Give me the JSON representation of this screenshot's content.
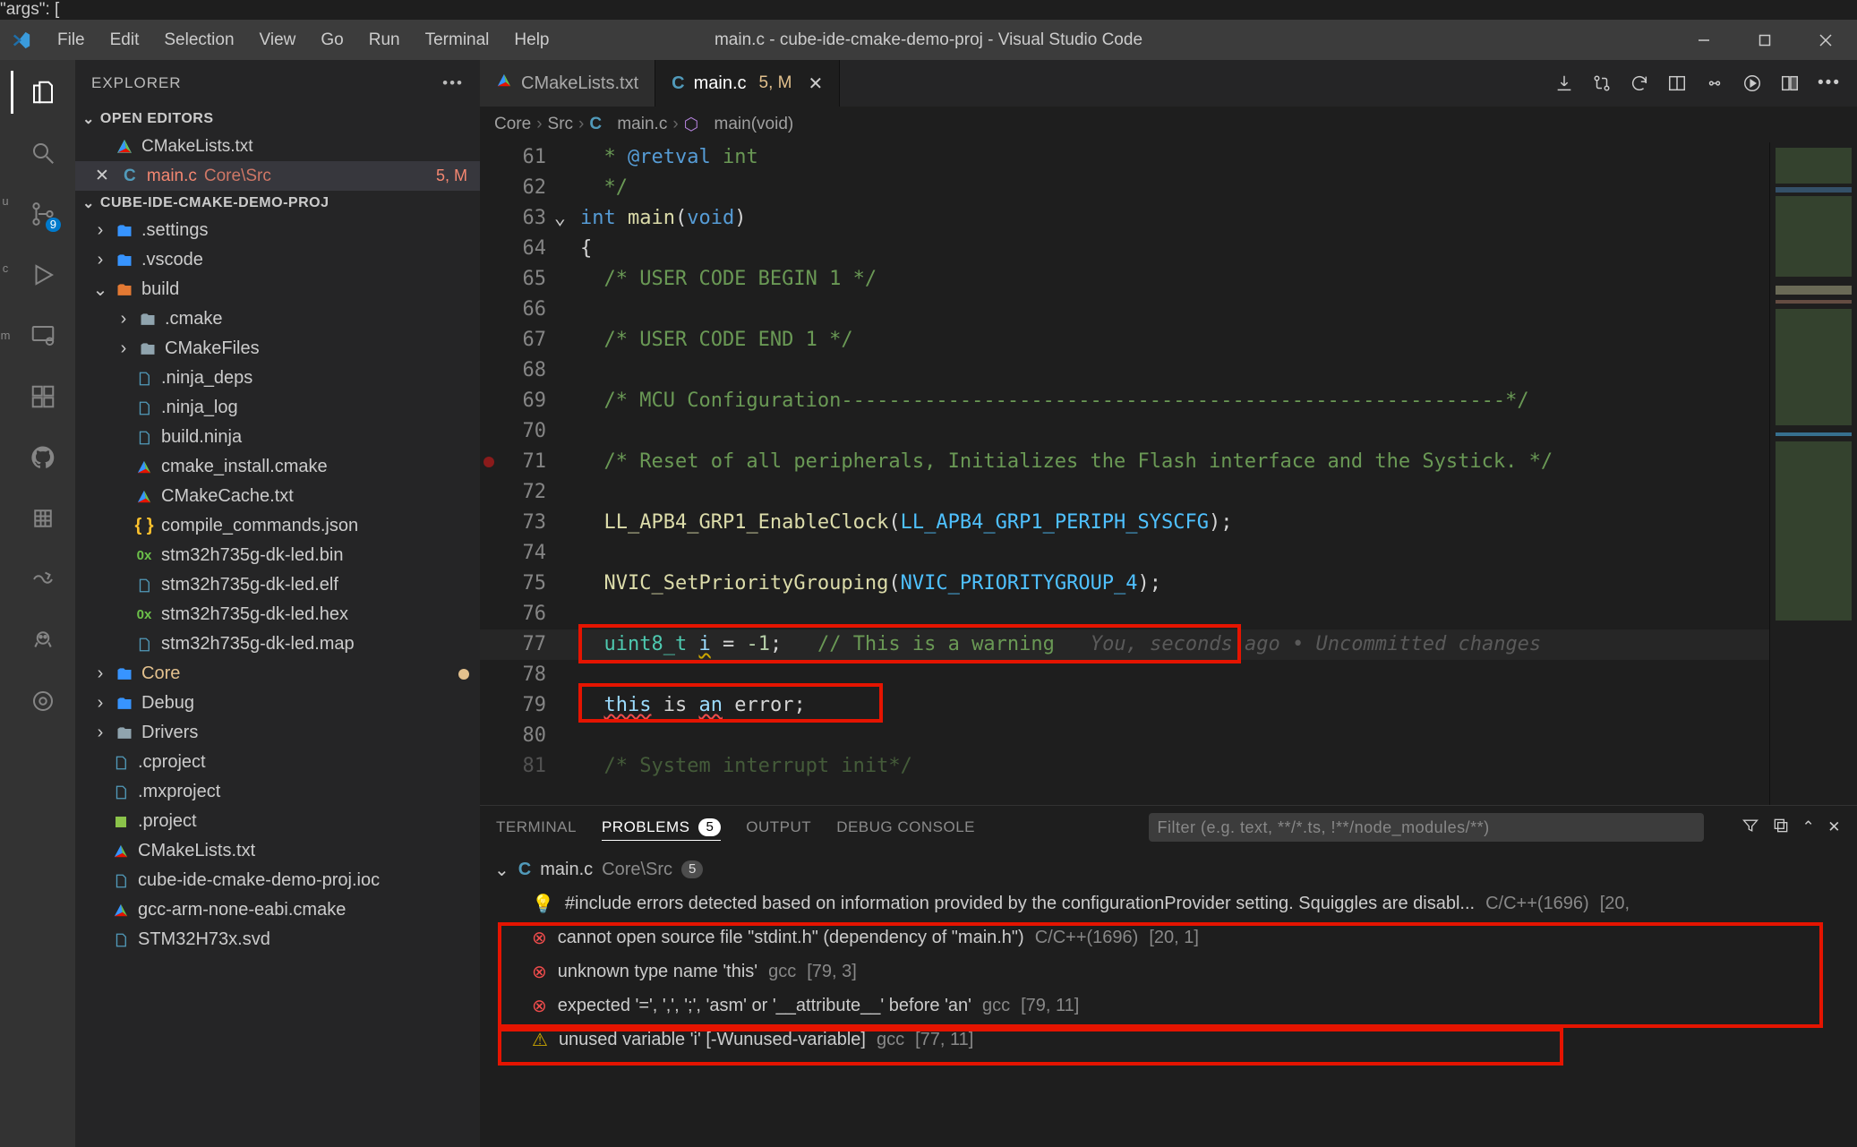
{
  "title": "main.c - cube-ide-cmake-demo-proj - Visual Studio Code",
  "top_snippet": "\"args\": [",
  "menu": [
    "File",
    "Edit",
    "Selection",
    "View",
    "Go",
    "Run",
    "Terminal",
    "Help"
  ],
  "left_letters": [
    "u",
    "c",
    "m"
  ],
  "sidebar": {
    "title": "EXPLORER",
    "sections": {
      "open_editors": {
        "label": "OPEN EDITORS",
        "items": [
          {
            "icon": "cmake-triangle",
            "name": "CMakeLists.txt",
            "close": false
          },
          {
            "icon": "c-file",
            "name": "main.c",
            "sub": "Core\\Src",
            "status": "5, M",
            "close": true,
            "active": true
          }
        ]
      },
      "folder": {
        "label": "CUBE-IDE-CMAKE-DEMO-PROJ",
        "tree": [
          {
            "depth": 0,
            "chev": "right",
            "icon": "folder-blue",
            "name": ".settings"
          },
          {
            "depth": 0,
            "chev": "right",
            "icon": "folder-blue",
            "name": ".vscode"
          },
          {
            "depth": 0,
            "chev": "down",
            "icon": "folder-red",
            "name": "build"
          },
          {
            "depth": 1,
            "chev": "right",
            "icon": "folder-grey",
            "name": ".cmake"
          },
          {
            "depth": 1,
            "chev": "right",
            "icon": "folder-grey",
            "name": "CMakeFiles"
          },
          {
            "depth": 1,
            "icon": "file-blue",
            "name": ".ninja_deps"
          },
          {
            "depth": 1,
            "icon": "file-blue",
            "name": ".ninja_log"
          },
          {
            "depth": 1,
            "icon": "file-blue",
            "name": "build.ninja"
          },
          {
            "depth": 1,
            "icon": "cmake-triangle",
            "name": "cmake_install.cmake"
          },
          {
            "depth": 1,
            "icon": "cmake-triangle",
            "name": "CMakeCache.txt"
          },
          {
            "depth": 1,
            "icon": "json-file",
            "name": "compile_commands.json"
          },
          {
            "depth": 1,
            "icon": "hex-file",
            "name": "stm32h735g-dk-led.bin"
          },
          {
            "depth": 1,
            "icon": "file-blue",
            "name": "stm32h735g-dk-led.elf"
          },
          {
            "depth": 1,
            "icon": "hex-file",
            "name": "stm32h735g-dk-led.hex"
          },
          {
            "depth": 1,
            "icon": "file-blue",
            "name": "stm32h735g-dk-led.map"
          },
          {
            "depth": 0,
            "chev": "right",
            "icon": "folder-blue",
            "name": "Core",
            "git": "mod",
            "dot": true
          },
          {
            "depth": 0,
            "chev": "right",
            "icon": "folder-blue",
            "name": "Debug"
          },
          {
            "depth": 0,
            "chev": "right",
            "icon": "folder-grey",
            "name": "Drivers"
          },
          {
            "depth": 0,
            "icon": "file-blue",
            "name": ".cproject"
          },
          {
            "depth": 0,
            "icon": "file-blue",
            "name": ".mxproject"
          },
          {
            "depth": 0,
            "icon": "project-file",
            "name": ".project"
          },
          {
            "depth": 0,
            "icon": "cmake-triangle",
            "name": "CMakeLists.txt"
          },
          {
            "depth": 0,
            "icon": "file-blue",
            "name": "cube-ide-cmake-demo-proj.ioc"
          },
          {
            "depth": 0,
            "icon": "cmake-triangle",
            "name": "gcc-arm-none-eabi.cmake"
          },
          {
            "depth": 0,
            "icon": "file-blue",
            "name": "STM32H73x.svd"
          }
        ]
      }
    }
  },
  "activity_badges": {
    "scm": "9"
  },
  "tabs": [
    {
      "icon": "cmake-triangle",
      "label": "CMakeLists.txt",
      "active": false
    },
    {
      "icon": "c-file",
      "label": "main.c",
      "meta": "5, M",
      "active": true,
      "closeable": true
    }
  ],
  "breadcrumbs": [
    {
      "text": "Core"
    },
    {
      "text": "Src"
    },
    {
      "icon": "c-file",
      "text": "main.c"
    },
    {
      "icon": "symbol-method",
      "text": "main(void)"
    }
  ],
  "editor": {
    "lines": [
      {
        "n": 61,
        "tokens": [
          {
            "c": "tok-doc",
            "t": "  * "
          },
          {
            "c": "tok-key",
            "t": "@retval"
          },
          {
            "c": "tok-doc",
            "t": " int"
          }
        ]
      },
      {
        "n": 62,
        "tokens": [
          {
            "c": "tok-doc",
            "t": "  */"
          }
        ]
      },
      {
        "n": 63,
        "fold": true,
        "tokens": [
          {
            "c": "tok-key",
            "t": "int "
          },
          {
            "c": "tok-func",
            "t": "main"
          },
          {
            "c": "tok-plain",
            "t": "("
          },
          {
            "c": "tok-key",
            "t": "void"
          },
          {
            "c": "tok-plain",
            "t": ")"
          }
        ]
      },
      {
        "n": 64,
        "tokens": [
          {
            "c": "tok-plain",
            "t": "{"
          }
        ]
      },
      {
        "n": 65,
        "tokens": [
          {
            "c": "tok-com",
            "t": "  /* USER CODE BEGIN 1 */"
          }
        ]
      },
      {
        "n": 66,
        "tokens": []
      },
      {
        "n": 67,
        "tokens": [
          {
            "c": "tok-com",
            "t": "  /* USER CODE END 1 */"
          }
        ]
      },
      {
        "n": 68,
        "tokens": []
      },
      {
        "n": 69,
        "tokens": [
          {
            "c": "tok-com",
            "t": "  /* MCU Configuration--------------------------------------------------------*/"
          }
        ]
      },
      {
        "n": 70,
        "tokens": []
      },
      {
        "n": 71,
        "bp": true,
        "tokens": [
          {
            "c": "tok-com",
            "t": "  /* Reset of all peripherals, Initializes the Flash interface and the Systick. */"
          }
        ]
      },
      {
        "n": 72,
        "tokens": []
      },
      {
        "n": 73,
        "tokens": [
          {
            "c": "tok-plain",
            "t": "  "
          },
          {
            "c": "tok-func",
            "t": "LL_APB4_GRP1_EnableClock"
          },
          {
            "c": "tok-plain",
            "t": "("
          },
          {
            "c": "tok-const",
            "t": "LL_APB4_GRP1_PERIPH_SYSCFG"
          },
          {
            "c": "tok-plain",
            "t": ");"
          }
        ]
      },
      {
        "n": 74,
        "tokens": []
      },
      {
        "n": 75,
        "tokens": [
          {
            "c": "tok-plain",
            "t": "  "
          },
          {
            "c": "tok-func",
            "t": "NVIC_SetPriorityGrouping"
          },
          {
            "c": "tok-plain",
            "t": "("
          },
          {
            "c": "tok-const",
            "t": "NVIC_PRIORITYGROUP_4"
          },
          {
            "c": "tok-plain",
            "t": ");"
          }
        ]
      },
      {
        "n": 76,
        "tokens": []
      },
      {
        "n": 77,
        "mod": true,
        "active": true,
        "tokens": [
          {
            "c": "tok-plain",
            "t": "  "
          },
          {
            "c": "tok-type",
            "t": "uint8_t"
          },
          {
            "c": "tok-plain",
            "t": " "
          },
          {
            "c": "tok-id sq-warn",
            "t": "i"
          },
          {
            "c": "tok-plain",
            "t": " = "
          },
          {
            "c": "tok-num",
            "t": "-1"
          },
          {
            "c": "tok-plain",
            "t": ";   "
          },
          {
            "c": "tok-com",
            "t": "// This is a warning"
          }
        ],
        "blame": "You, seconds ago • Uncommitted changes"
      },
      {
        "n": 78,
        "mod": true,
        "tokens": []
      },
      {
        "n": 79,
        "mod": true,
        "tokens": [
          {
            "c": "tok-plain",
            "t": "  "
          },
          {
            "c": "tok-id sq-err",
            "t": "this"
          },
          {
            "c": "tok-plain",
            "t": " is "
          },
          {
            "c": "tok-id sq-err",
            "t": "an"
          },
          {
            "c": "tok-plain",
            "t": " error;"
          }
        ]
      },
      {
        "n": 80,
        "mod": true,
        "tokens": []
      },
      {
        "n": 81,
        "cut": true,
        "tokens": [
          {
            "c": "tok-com",
            "t": "  /* System interrupt init*/"
          }
        ]
      }
    ]
  },
  "panel": {
    "tabs": [
      {
        "label": "TERMINAL"
      },
      {
        "label": "PROBLEMS",
        "count": "5",
        "active": true
      },
      {
        "label": "OUTPUT"
      },
      {
        "label": "DEBUG CONSOLE"
      }
    ],
    "filter_placeholder": "Filter (e.g. text, **/*.ts, !**/node_modules/**)",
    "problems": {
      "file": {
        "icon": "c-file",
        "name": "main.c",
        "sub": "Core\\Src",
        "count": "5"
      },
      "items": [
        {
          "sev": "bulb",
          "msg": "#include errors detected based on information provided by the configurationProvider setting. Squiggles are disabl...",
          "src": "C/C++(1696)",
          "loc": "[20,"
        },
        {
          "sev": "error",
          "msg": "cannot open source file \"stdint.h\" (dependency of \"main.h\")",
          "src": "C/C++(1696)",
          "loc": "[20, 1]"
        },
        {
          "sev": "error",
          "msg": "unknown type name 'this'",
          "src": "gcc",
          "loc": "[79, 3]"
        },
        {
          "sev": "error",
          "msg": "expected '=', ',', ';', 'asm' or '__attribute__' before 'an'",
          "src": "gcc",
          "loc": "[79, 11]"
        },
        {
          "sev": "warn",
          "msg": "unused variable 'i' [-Wunused-variable]",
          "src": "gcc",
          "loc": "[77, 11]"
        }
      ]
    }
  }
}
